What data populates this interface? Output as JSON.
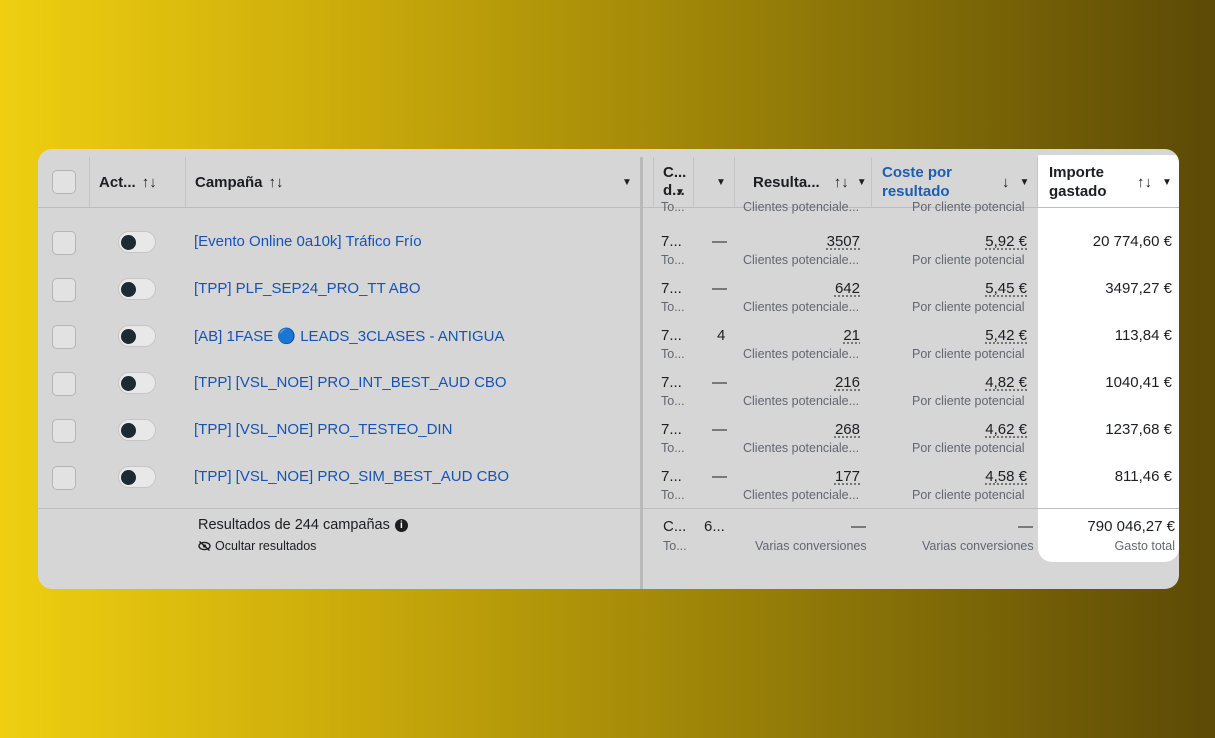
{
  "header": {
    "act": "Act...",
    "campaign": "Campaña",
    "col_c": "C...",
    "col_d": "d...",
    "results": "Resulta...",
    "cost_line1": "Coste por",
    "cost_line2": "resultado",
    "spent_line1": "Importe",
    "spent_line2": "gastado",
    "sort_arrows": "↑↓",
    "sort_down": "↓",
    "caret": "▼"
  },
  "partial_row": {
    "col_c": "To...",
    "results_label": "Clientes potenciale...",
    "cost_label": "Por cliente potencial"
  },
  "rows": [
    {
      "name": "[Evento Online 0a10k] Tráfico Frío",
      "c_top": "7...",
      "c_bottom": "To...",
      "d": "—",
      "results": "3507",
      "results_label": "Clientes potenciale...",
      "cost": "5,92 €",
      "cost_label": "Por cliente potencial",
      "spent": "20 774,60 €"
    },
    {
      "name": "[TPP] PLF_SEP24_PRO_TT ABO",
      "c_top": "7...",
      "c_bottom": "To...",
      "d": "—",
      "results": "642",
      "results_label": "Clientes potenciale...",
      "cost": "5,45 €",
      "cost_label": "Por cliente potencial",
      "spent": "3497,27 €"
    },
    {
      "name": "[AB] 1FASE 🔵 LEADS_3CLASES - ANTIGUA",
      "c_top": "7...",
      "c_bottom": "To...",
      "d": "4",
      "results": "21",
      "results_label": "Clientes potenciale...",
      "cost": "5,42 €",
      "cost_label": "Por cliente potencial",
      "spent": "113,84 €"
    },
    {
      "name": "[TPP] [VSL_NOE] PRO_INT_BEST_AUD CBO",
      "c_top": "7...",
      "c_bottom": "To...",
      "d": "—",
      "results": "216",
      "results_label": "Clientes potenciale...",
      "cost": "4,82 €",
      "cost_label": "Por cliente potencial",
      "spent": "1040,41 €"
    },
    {
      "name": "[TPP] [VSL_NOE] PRO_TESTEO_DIN",
      "c_top": "7...",
      "c_bottom": "To...",
      "d": "—",
      "results": "268",
      "results_label": "Clientes potenciale...",
      "cost": "4,62 €",
      "cost_label": "Por cliente potencial",
      "spent": "1237,68 €"
    },
    {
      "name": "[TPP] [VSL_NOE] PRO_SIM_BEST_AUD CBO",
      "c_top": "7...",
      "c_bottom": "To...",
      "d": "—",
      "results": "177",
      "results_label": "Clientes potenciale...",
      "cost": "4,58 €",
      "cost_label": "Por cliente potencial",
      "spent": "811,46 €"
    }
  ],
  "footer": {
    "results_of": "Resultados de 244 campañas",
    "hide_results": "Ocultar resultados",
    "c_top": "C...",
    "c_bottom": "To...",
    "d_top": "6...",
    "results_dash": "—",
    "results_label": "Varias conversiones",
    "cost_dash": "—",
    "cost_label": "Varias conversiones",
    "spent": "790 046,27 €",
    "spent_label": "Gasto total"
  },
  "colors": {
    "link": "#1654b4",
    "cost_header": "#1a5fb4",
    "toggle_knob": "#1c2b33"
  },
  "icons": {
    "sort": "sort-arrows-icon",
    "dropdown": "chevron-down-icon",
    "info": "info-icon",
    "hide": "eye-slash-icon"
  }
}
